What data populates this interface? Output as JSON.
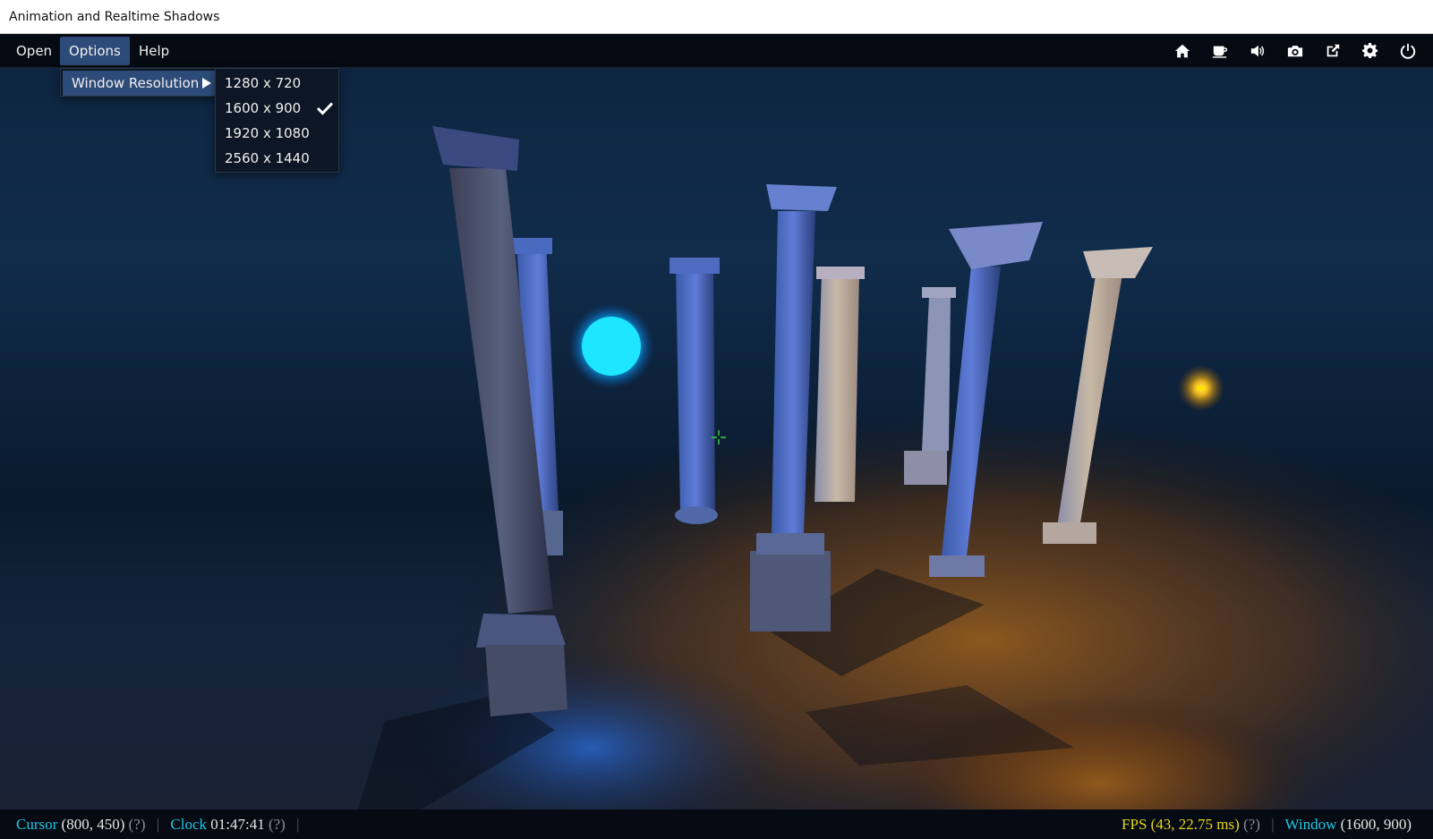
{
  "window": {
    "title": "Animation and Realtime Shadows"
  },
  "menubar": {
    "items": [
      {
        "label": "Open"
      },
      {
        "label": "Options"
      },
      {
        "label": "Help"
      }
    ],
    "active": "Options",
    "toolbar_icons": [
      "home-icon",
      "coffee-icon",
      "volume-icon",
      "camera-icon",
      "external-link-icon",
      "gear-icon",
      "power-icon"
    ]
  },
  "options_menu": {
    "items": [
      {
        "label": "Window Resolution",
        "has_submenu": true
      }
    ]
  },
  "resolution_submenu": {
    "items": [
      {
        "label": "1280 x 720",
        "checked": false
      },
      {
        "label": "1600 x 900",
        "checked": true
      },
      {
        "label": "1920 x 1080",
        "checked": false
      },
      {
        "label": "2560 x 1440",
        "checked": false
      }
    ]
  },
  "statusbar": {
    "cursor_label": "Cursor",
    "cursor_value": "(800, 450)",
    "cursor_help": "(?)",
    "clock_label": "Clock",
    "clock_value": "01:47:41",
    "clock_help": "(?)",
    "fps_text": "FPS (43, 22.75 ms)",
    "fps_help": "(?)",
    "window_label": "Window",
    "window_value": "(1600, 900)"
  },
  "colors": {
    "accent_highlight": "#2d4b78",
    "status_cyan": "#19c7e6",
    "status_yellow": "#e6d61a",
    "light_blue": "#1ee6ff",
    "light_orange": "#ffc21a"
  }
}
